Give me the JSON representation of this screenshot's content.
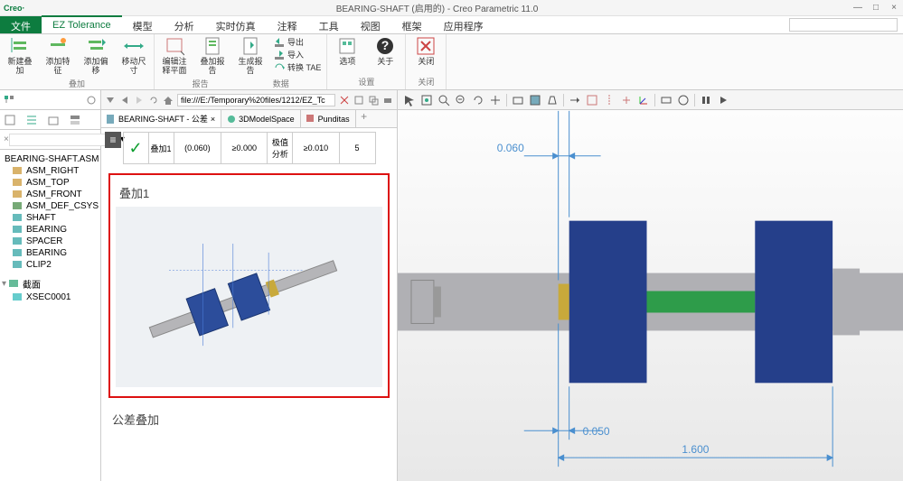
{
  "app": {
    "name": "Creo·",
    "title": "BEARING-SHAFT (启用的) - Creo Parametric 11.0"
  },
  "ribbon": {
    "tabs": [
      "文件",
      "EZ Tolerance",
      "模型",
      "分析",
      "实时仿真",
      "注释",
      "工具",
      "视图",
      "框架",
      "应用程序"
    ],
    "active_index": 1,
    "groups": {
      "stack": {
        "label": "叠加",
        "buttons": [
          {
            "label": "新建叠加"
          },
          {
            "label": "添加特征"
          },
          {
            "label": "添加偏移"
          },
          {
            "label": "移动尺寸"
          }
        ]
      },
      "report": {
        "label": "报告",
        "buttons": [
          {
            "label": "编辑注释平面"
          },
          {
            "label": "叠加报告"
          },
          {
            "label": "生成报告"
          }
        ],
        "small": [
          {
            "label": "导出"
          },
          {
            "label": "导入"
          },
          {
            "label": "转换 TAE"
          }
        ]
      },
      "data": {
        "label": "数据"
      },
      "settings": {
        "label": "设置",
        "buttons": [
          {
            "label": "选项"
          },
          {
            "label": "关于"
          }
        ]
      },
      "close": {
        "label": "关闭",
        "buttons": [
          {
            "label": "关闭"
          }
        ]
      }
    }
  },
  "detail": {
    "url": "file:///E:/Temporary%20files/1212/EZ_Tc",
    "tabs": [
      {
        "label": "BEARING-SHAFT - 公差",
        "active": true
      },
      {
        "label": "3DModelSpace"
      },
      {
        "label": "Punditas"
      }
    ],
    "table": {
      "row": {
        "name": "叠加1",
        "val1": "(0.060)",
        "val2": "≥0.000",
        "col3": "极值分析",
        "val3": "≥0.010",
        "val4": "5"
      }
    },
    "stackup_title": "叠加1",
    "section2_title": "公差叠加"
  },
  "tree": {
    "root": "BEARING-SHAFT.ASM",
    "items": [
      {
        "label": "ASM_RIGHT",
        "ico": "plane"
      },
      {
        "label": "ASM_TOP",
        "ico": "plane"
      },
      {
        "label": "ASM_FRONT",
        "ico": "plane"
      },
      {
        "label": "ASM_DEF_CSYS",
        "ico": "csys"
      },
      {
        "label": "SHAFT",
        "ico": "part"
      },
      {
        "label": "BEARING",
        "ico": "part"
      },
      {
        "label": "SPACER",
        "ico": "part"
      },
      {
        "label": "BEARING",
        "ico": "part"
      },
      {
        "label": "CLIP2",
        "ico": "part"
      }
    ],
    "section": {
      "label": "截面",
      "child": "XSEC0001"
    }
  },
  "viewport": {
    "dims": {
      "top": "0.060",
      "bottom": "0.050",
      "overall": "1.600"
    }
  }
}
